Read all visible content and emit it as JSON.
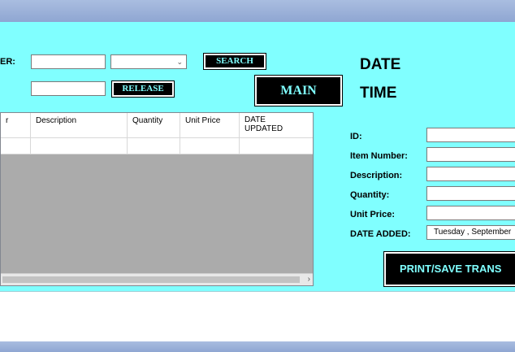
{
  "search": {
    "label_fragment": "ER:",
    "search_button": "SEARCH",
    "release_button": "RELEASE",
    "main_button": "MAIN",
    "text_value": "",
    "combo_value": "",
    "release_value": ""
  },
  "datetime": {
    "date": "DATE",
    "time": "TIME"
  },
  "grid": {
    "columns": [
      "r",
      "Description",
      "Quantity",
      "Unit Price",
      "DATE UPDATED"
    ],
    "rows": [
      [
        "",
        "",
        "",
        "",
        ""
      ]
    ]
  },
  "form": {
    "id_label": "ID:",
    "item_label": "Item Number:",
    "desc_label": "Description:",
    "qty_label": "Quantity:",
    "price_label": "Unit Price:",
    "date_label": "DATE ADDED:",
    "date_value": "Tuesday   , September",
    "print_button": "PRINT/SAVE TRANS"
  },
  "colors": {
    "panel": "#80ffff",
    "button_bg": "#000000",
    "button_text": "#80ffff"
  }
}
